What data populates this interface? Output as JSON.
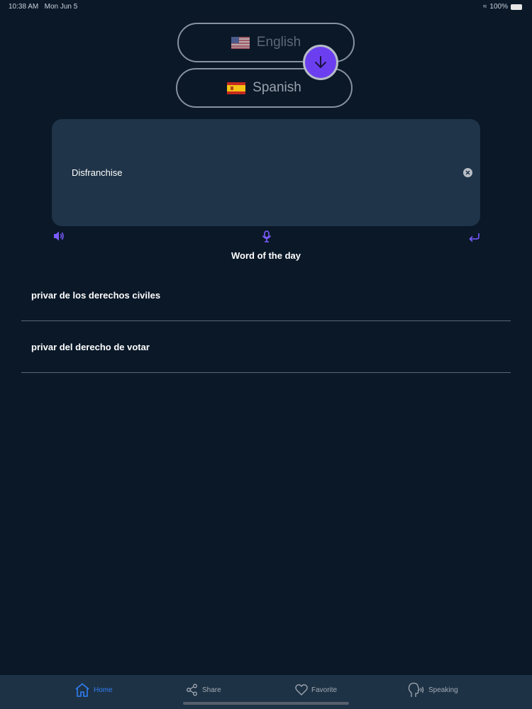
{
  "status_bar": {
    "time": "10:38 AM",
    "date": "Mon Jun 5",
    "battery": "100%"
  },
  "languages": {
    "source": {
      "label": "English",
      "flag": "us-flag-icon"
    },
    "target": {
      "label": "Spanish",
      "flag": "es-flag-icon"
    },
    "swap_icon": "arrow-down-icon"
  },
  "input": {
    "value": "Disfranchise",
    "clear_icon": "clear-icon"
  },
  "tools": {
    "speaker_icon": "speaker-icon",
    "mic_icon": "microphone-icon",
    "return_icon": "return-icon"
  },
  "word_of_day": "Word of the day",
  "results": [
    "privar de los derechos civiles",
    "privar del derecho de votar"
  ],
  "tabs": [
    {
      "label": "Home",
      "icon": "home-icon",
      "active": true
    },
    {
      "label": "Share",
      "icon": "share-icon",
      "active": false
    },
    {
      "label": "Favorite",
      "icon": "heart-icon",
      "active": false
    },
    {
      "label": "Speaking",
      "icon": "speaking-head-icon",
      "active": false
    }
  ],
  "colors": {
    "background": "#0a1828",
    "card": "#1f3448",
    "accent": "#6b3ff0",
    "active_tab": "#2f7ff5"
  }
}
